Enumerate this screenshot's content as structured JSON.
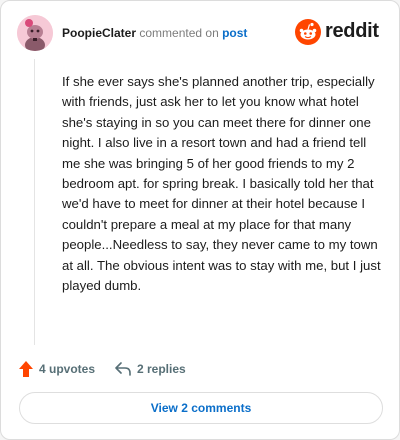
{
  "header": {
    "username": "PoopieClater",
    "action_text": "commented on",
    "post_link": "post",
    "logo_text": "reddit",
    "logo_icon": "reddit-alien-icon"
  },
  "comment": {
    "body": "If she ever says she's planned another trip, especially with friends, just ask her to let you know what hotel she's staying in so you can meet there for dinner one night. I also live in a resort town and had a friend tell me she was bringing 5 of her good friends to my 2 bedroom apt. for spring break. I basically told her that we'd have to meet for dinner at their hotel because I couldn't prepare a meal at my place for that many people...Needless to say, they never came to my town at all. The obvious intent was to stay with me, but I just played dumb."
  },
  "actions": {
    "upvotes_label": "4 upvotes",
    "upvote_icon": "upvote-arrow-icon",
    "replies_label": "2 replies",
    "reply_icon": "reply-arrow-icon"
  },
  "footer": {
    "view_comments_label": "View 2 comments"
  },
  "colors": {
    "brand_orange": "#ff4500",
    "link_blue": "#0a6ec9",
    "upvote_orange": "#ff4500",
    "avatar_bg": "#f6c9d6"
  }
}
